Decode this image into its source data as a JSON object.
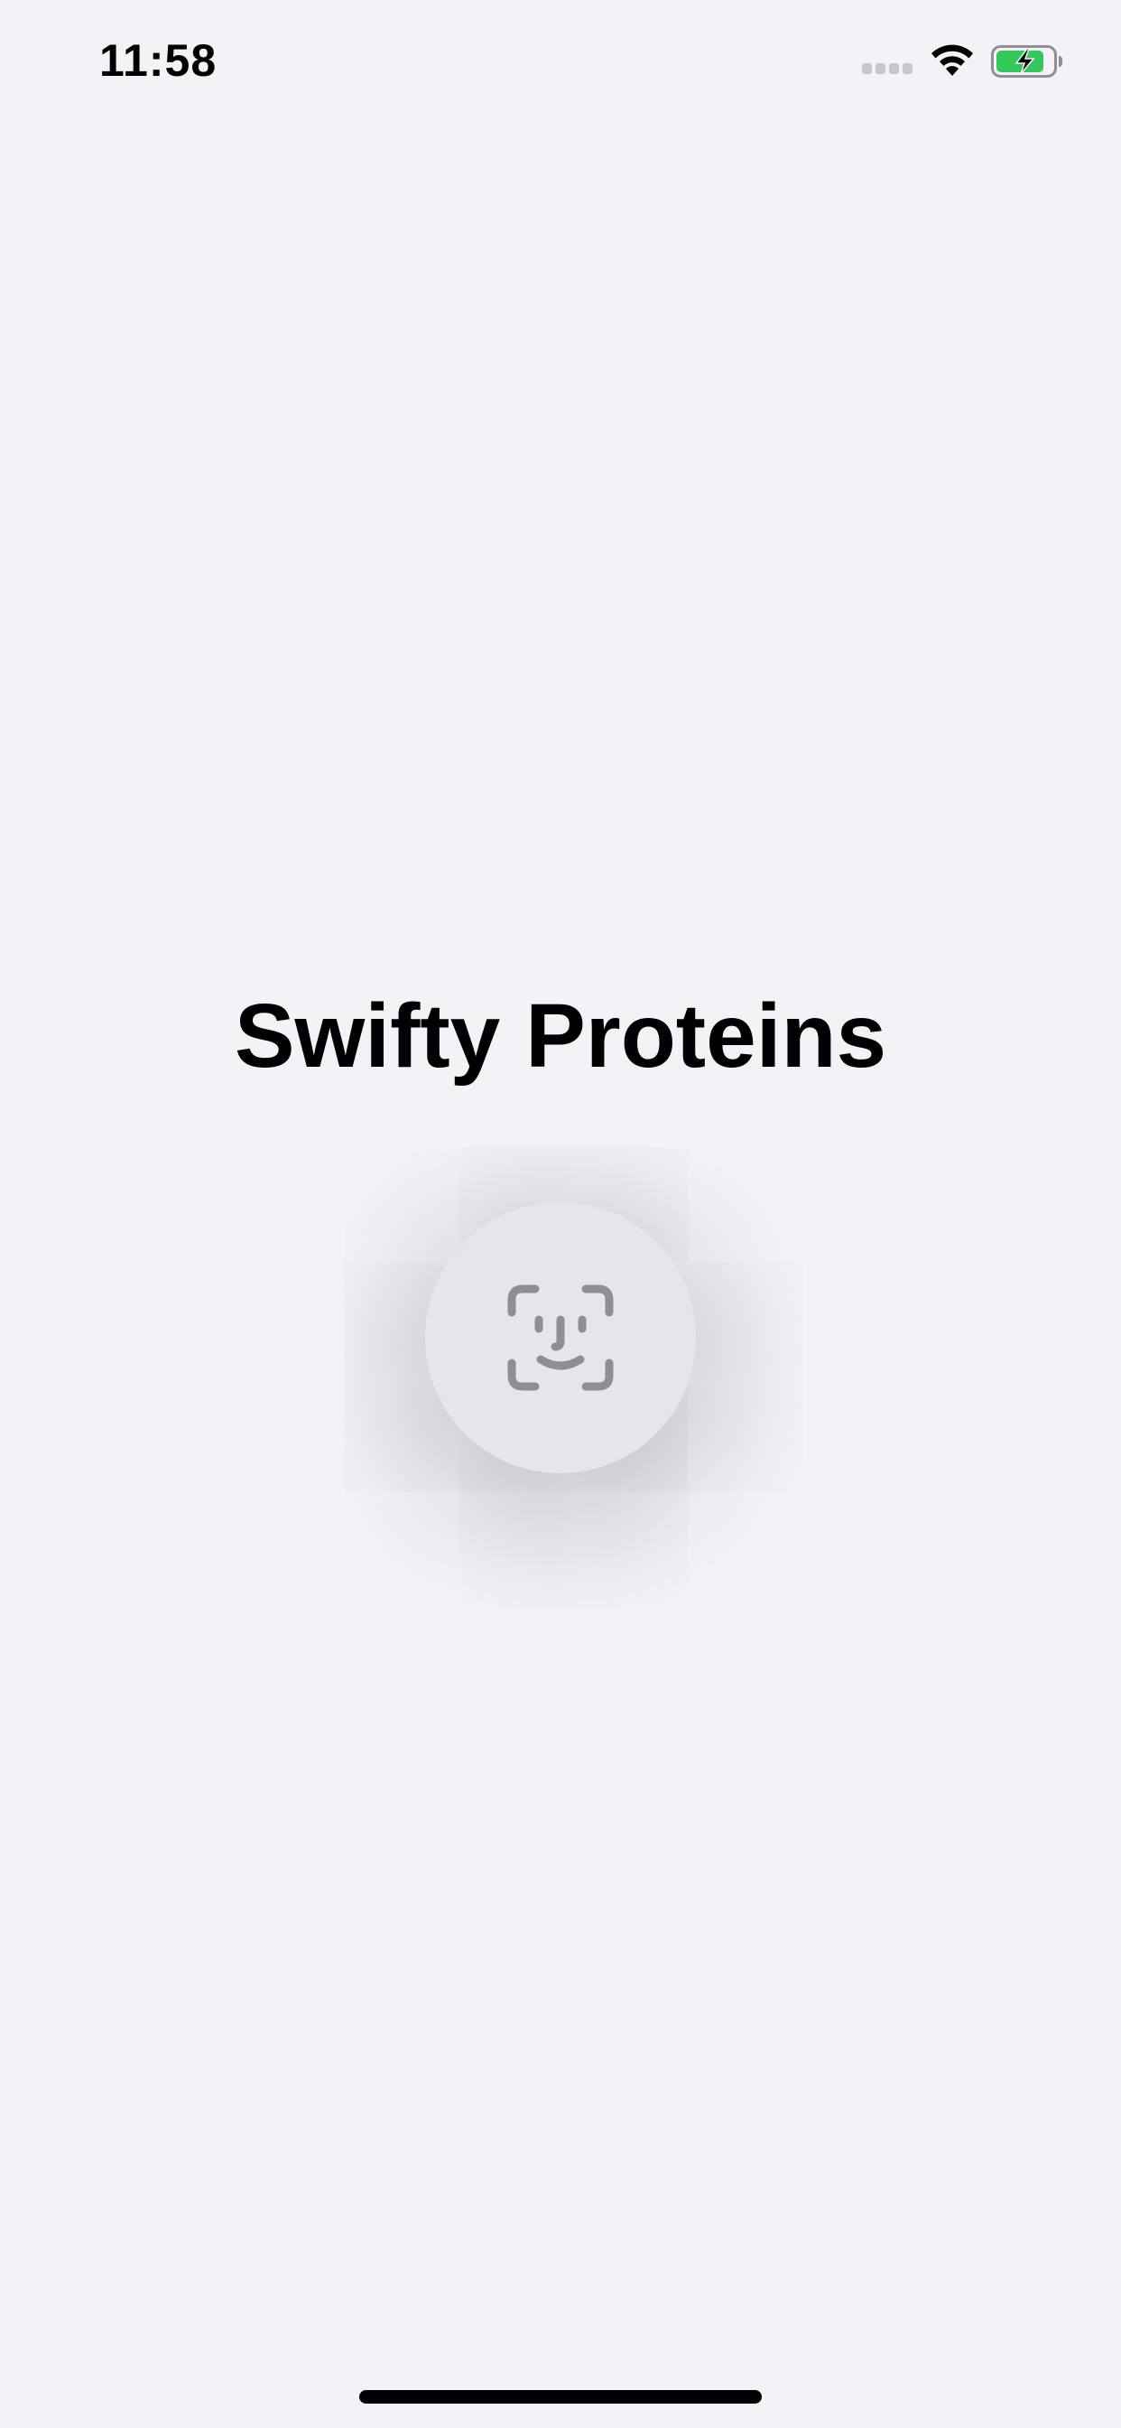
{
  "status_bar": {
    "time": "11:58",
    "signal_icon": "cellular-signal-icon",
    "wifi_icon": "wifi-icon",
    "battery_icon": "battery-charging-icon"
  },
  "main": {
    "title": "Swifty Proteins",
    "faceid_icon": "face-id-icon"
  },
  "colors": {
    "background": "#f2f2f7",
    "button_background": "#e5e5ea",
    "icon_gray": "#8e8e93",
    "battery_green": "#34c759"
  }
}
